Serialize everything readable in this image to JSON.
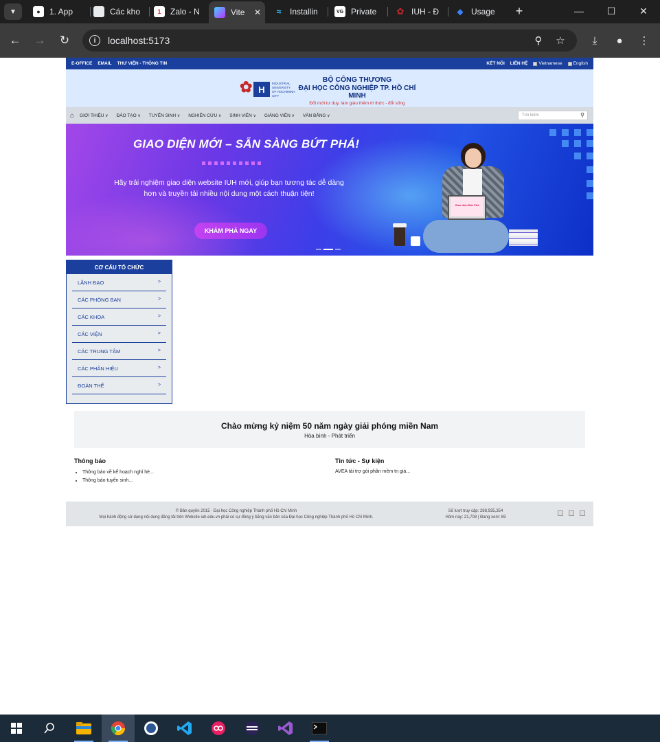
{
  "browser": {
    "tabs": [
      {
        "title": "1. App",
        "fav_color": "#1f1f1f",
        "fav_text": ""
      },
      {
        "title": "Các kho",
        "fav_color": "#ffffff",
        "fav_text": ""
      },
      {
        "title": "Zalo - N",
        "fav_color": "#e53935",
        "fav_text": "1"
      },
      {
        "title": "Vite",
        "fav_color": "#8b5cf6",
        "fav_text": ""
      },
      {
        "title": "Installin",
        "fav_color": "#1f1f1f",
        "fav_text": ""
      },
      {
        "title": "Private",
        "fav_color": "#ffffff",
        "fav_text": "VG"
      },
      {
        "title": "IUH - Đ",
        "fav_color": "#c62828",
        "fav_text": ""
      },
      {
        "title": "Usage",
        "fav_color": "#3b82f6",
        "fav_text": ""
      }
    ],
    "url": "localhost:5173"
  },
  "site": {
    "topbar_left": [
      "E-OFFICE",
      "EMAIL",
      "THƯ VIỆN - THÔNG TIN"
    ],
    "topbar_right": [
      "KẾT NỐI",
      "LIÊN HỆ"
    ],
    "flag_vn": "Vietnamese",
    "flag_en": "English",
    "logo_sub": "INDUSTRIAL UNIVERSITY OF HOCHIMINH CITY",
    "header_line1": "BỘ CÔNG THƯƠNG",
    "header_line2": "ĐẠI HỌC CÔNG NGHIỆP TP. HỒ CHÍ MINH",
    "header_line3": "Đổi mới tư duy, làm giàu thêm tri thức - đổi sống",
    "nav": [
      "GIỚI THIỆU",
      "ĐÀO TẠO",
      "TUYỂN SINH",
      "NGHIÊN CỨU",
      "SINH VIÊN",
      "GIẢNG VIÊN",
      "VĂN BẰNG"
    ],
    "search_placeholder": "Tìm kiếm",
    "hero_title": "GIAO DIỆN MỚI – SẴN SÀNG BỨT PHÁ!",
    "hero_desc": "Hãy trải nghiệm giao diện website IUH mới, giúp bạn tương tác dễ dàng hơn và truyền tải nhiều nội dung một cách thuận tiện!",
    "hero_cta": "KHÁM PHÁ NGAY",
    "laptop_text": "Giao diện Bứt Phá",
    "sidebox_title": "CƠ CẤU TỔ CHỨC",
    "sidebox_items": [
      "LÃNH ĐẠO",
      "CÁC PHÒNG BAN",
      "CÁC KHOA",
      "CÁC VIỆN",
      "CÁC TRUNG TÂM",
      "CÁC PHÂN HIỆU",
      "ĐOÀN THỂ"
    ],
    "celebrate_title": "Chào mừng kỷ niệm 50 năm ngày giải phóng miền Nam",
    "celebrate_sub": "Hòa bình - Phát triển",
    "notice_title": "Thông báo",
    "notice_items": [
      "Thông báo về kế hoạch nghỉ hè...",
      "Thông báo tuyển sinh..."
    ],
    "news_title": "Tin tức - Sự kiện",
    "news_item": "AVEA tài trợ gói phần mềm trị giá...",
    "footer_l1": "© Bản quyền 2015 · Đại học Công nghiệp Thành phố Hồ Chí Minh",
    "footer_l2": "Mọi hành động sử dụng nội dung đăng tải trên Website iuh.edu.vn phải có sự đồng ý bằng văn bản của Đại học Công nghiệp Thành phố Hồ Chí Minh.",
    "footer_r1": "Số lượt truy cập: 288,935,354",
    "footer_r2": "Hôm nay: 21,708 | Đang xem: 69"
  },
  "colors": {
    "brand": "#1a3f9c",
    "accent": "#c62828",
    "cta": "#b33ff0"
  },
  "icons": [
    "chevron-down-icon",
    "github-icon",
    "close-icon",
    "back-icon",
    "forward-icon",
    "reload-icon",
    "info-icon",
    "zoom-icon",
    "star-icon",
    "download-icon",
    "profile-icon",
    "menu-icon",
    "home-icon",
    "search-icon",
    "windows-icon"
  ]
}
